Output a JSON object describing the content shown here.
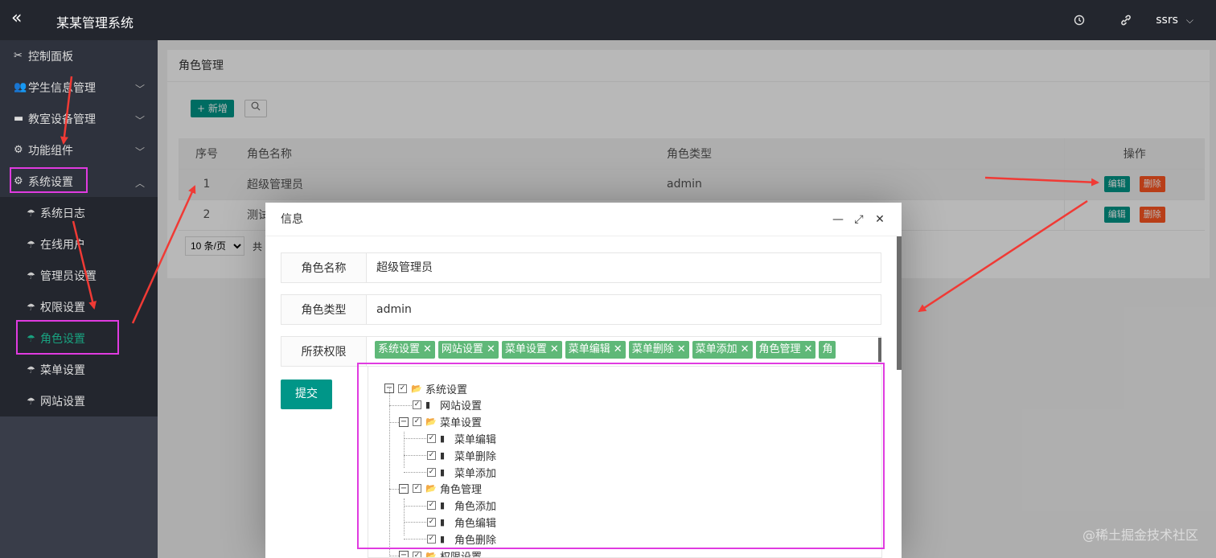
{
  "header": {
    "toggle_icon": "double-chevron-left-icon",
    "title": "某某管理系统",
    "icons": [
      "clock-icon",
      "link-icon"
    ],
    "user": "ssrs"
  },
  "sidebar": {
    "items": [
      {
        "label": "控制面板",
        "icon": "tools-icon",
        "expandable": false
      },
      {
        "label": "学生信息管理",
        "icon": "users-icon",
        "expandable": true
      },
      {
        "label": "教室设备管理",
        "icon": "monitor-icon",
        "expandable": true
      },
      {
        "label": "功能组件",
        "icon": "gear-icon",
        "expandable": true
      },
      {
        "label": "系统设置",
        "icon": "gear-icon",
        "expandable": true,
        "expanded": true
      }
    ],
    "sub_items": [
      {
        "label": "系统日志"
      },
      {
        "label": "在线用户"
      },
      {
        "label": "管理员设置"
      },
      {
        "label": "权限设置"
      },
      {
        "label": "角色设置",
        "active": true
      },
      {
        "label": "菜单设置"
      },
      {
        "label": "网站设置"
      }
    ]
  },
  "main": {
    "title": "角色管理",
    "add_button": "新增",
    "table": {
      "columns": [
        "序号",
        "角色名称",
        "角色类型",
        "操作"
      ],
      "rows": [
        {
          "no": "1",
          "name": "超级管理员",
          "type": "admin"
        },
        {
          "no": "2",
          "name": "测试",
          "type": ""
        }
      ],
      "edit_label": "编辑",
      "delete_label": "删除"
    },
    "pager": {
      "page_size": "10 条/页",
      "total_prefix": "共"
    }
  },
  "dialog": {
    "title": "信息",
    "fields": {
      "role_name_label": "角色名称",
      "role_name_value": "超级管理员",
      "role_type_label": "角色类型",
      "role_type_value": "admin",
      "perms_label": "所获权限"
    },
    "tags": [
      "系统设置",
      "网站设置",
      "菜单设置",
      "菜单编辑",
      "菜单删除",
      "菜单添加",
      "角色管理",
      "角"
    ],
    "submit": "提交",
    "tree": [
      {
        "label": "系统设置",
        "level": 0,
        "folder": true,
        "switch": "−"
      },
      {
        "label": "网站设置",
        "level": 1,
        "folder": false
      },
      {
        "label": "菜单设置",
        "level": 1,
        "folder": true,
        "switch": "−"
      },
      {
        "label": "菜单编辑",
        "level": 2,
        "folder": false
      },
      {
        "label": "菜单删除",
        "level": 2,
        "folder": false
      },
      {
        "label": "菜单添加",
        "level": 2,
        "folder": false
      },
      {
        "label": "角色管理",
        "level": 1,
        "folder": true,
        "switch": "−"
      },
      {
        "label": "角色添加",
        "level": 2,
        "folder": false
      },
      {
        "label": "角色编辑",
        "level": 2,
        "folder": false
      },
      {
        "label": "角色删除",
        "level": 2,
        "folder": false
      },
      {
        "label": "权限设置",
        "level": 1,
        "folder": true,
        "switch": "−"
      }
    ]
  },
  "annotation_color": "#e03be0",
  "arrow_color": "#f03a35",
  "watermark": "@稀土掘金技术社区"
}
